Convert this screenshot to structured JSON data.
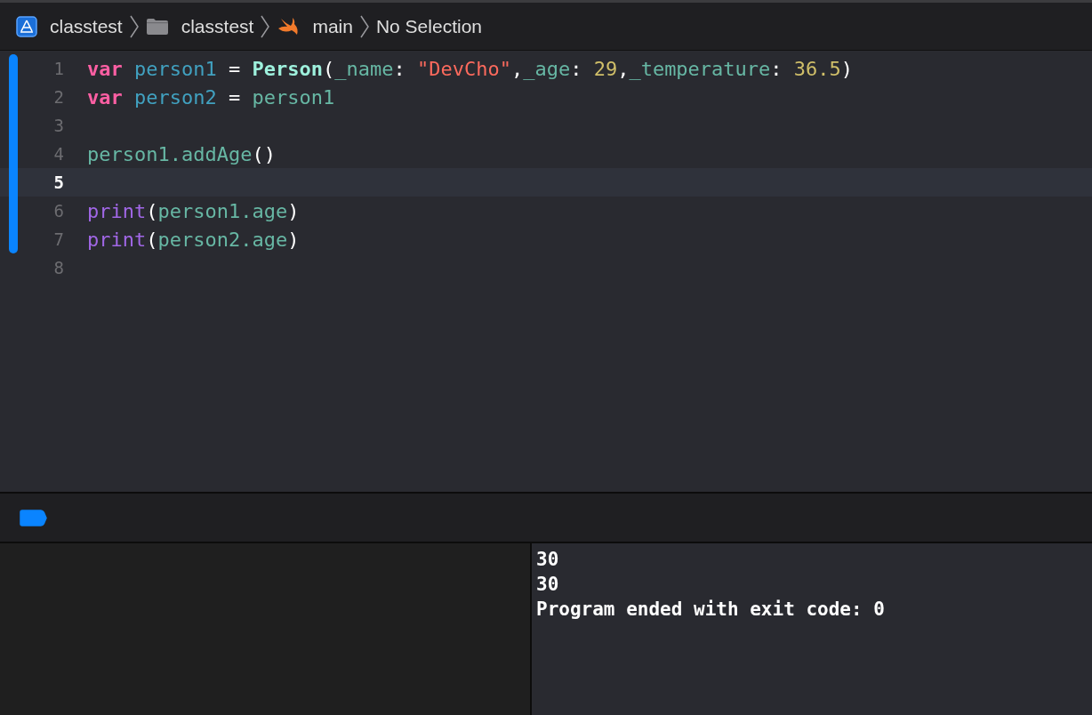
{
  "breadcrumb": [
    {
      "kind": "project",
      "label": "classtest"
    },
    {
      "kind": "folder",
      "label": "classtest"
    },
    {
      "kind": "swift",
      "label": "main"
    },
    {
      "kind": "plain",
      "label": "No Selection"
    }
  ],
  "editor": {
    "lines": [
      {
        "number": "1",
        "selected": false,
        "changed": true,
        "tokens": [
          {
            "kind": "keyword",
            "text": "var"
          },
          {
            "kind": "decl",
            "text": " person1"
          },
          {
            "kind": "plain",
            "text": " = "
          },
          {
            "kind": "type",
            "text": "Person"
          },
          {
            "kind": "plain",
            "text": "("
          },
          {
            "kind": "ident",
            "text": "_name"
          },
          {
            "kind": "plain",
            "text": ": "
          },
          {
            "kind": "string",
            "text": "\"DevCho\""
          },
          {
            "kind": "plain",
            "text": ","
          },
          {
            "kind": "ident",
            "text": "_age"
          },
          {
            "kind": "plain",
            "text": ": "
          },
          {
            "kind": "number",
            "text": "29"
          },
          {
            "kind": "plain",
            "text": ","
          },
          {
            "kind": "ident",
            "text": "_temperature"
          },
          {
            "kind": "plain",
            "text": ": "
          },
          {
            "kind": "number",
            "text": "36.5"
          },
          {
            "kind": "plain",
            "text": ")"
          }
        ]
      },
      {
        "number": "2",
        "selected": false,
        "changed": true,
        "tokens": [
          {
            "kind": "keyword",
            "text": "var"
          },
          {
            "kind": "decl",
            "text": " person2"
          },
          {
            "kind": "plain",
            "text": " = "
          },
          {
            "kind": "ident",
            "text": "person1"
          }
        ]
      },
      {
        "number": "3",
        "selected": false,
        "changed": true
      },
      {
        "number": "4",
        "selected": false,
        "changed": true,
        "tokens": [
          {
            "kind": "ident",
            "text": "person1.addAge"
          },
          {
            "kind": "plain",
            "text": "()"
          }
        ]
      },
      {
        "number": "5",
        "selected": true,
        "changed": true
      },
      {
        "number": "6",
        "selected": false,
        "changed": true,
        "tokens": [
          {
            "kind": "func",
            "text": "print"
          },
          {
            "kind": "plain",
            "text": "("
          },
          {
            "kind": "ident",
            "text": "person1.age"
          },
          {
            "kind": "plain",
            "text": ")"
          }
        ]
      },
      {
        "number": "7",
        "selected": false,
        "changed": true,
        "tokens": [
          {
            "kind": "func",
            "text": "print"
          },
          {
            "kind": "plain",
            "text": "("
          },
          {
            "kind": "ident",
            "text": "person2.age"
          },
          {
            "kind": "plain",
            "text": ")"
          }
        ]
      },
      {
        "number": "8",
        "selected": false,
        "changed": false
      }
    ]
  },
  "debug_bar": {
    "breakpoints_active": true
  },
  "console": {
    "lines": [
      "30",
      "30",
      "Program ended with exit code: 0"
    ]
  }
}
